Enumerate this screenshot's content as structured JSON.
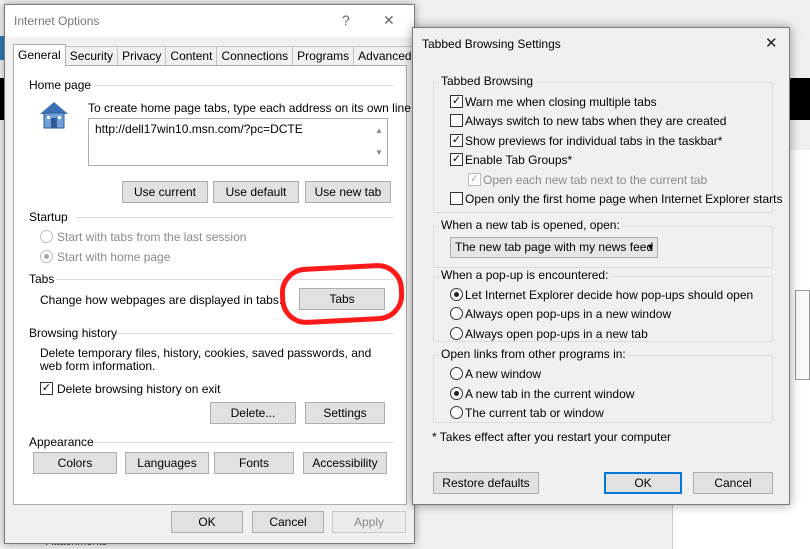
{
  "io": {
    "title": "Internet Options",
    "help": "?",
    "close": "✕",
    "tabs": [
      "General",
      "Security",
      "Privacy",
      "Content",
      "Connections",
      "Programs",
      "Advanced"
    ],
    "home_page": {
      "label": "Home page",
      "desc": "To create home page tabs, type each address on its own line.",
      "url": "http://dell17win10.msn.com/?pc=DCTE",
      "use_current": "Use current",
      "use_default": "Use default",
      "use_new_tab": "Use new tab"
    },
    "startup": {
      "label": "Startup",
      "opt1": "Start with tabs from the last session",
      "opt2": "Start with home page"
    },
    "tabs_group": {
      "label": "Tabs",
      "desc": "Change how webpages are displayed in tabs.",
      "button": "Tabs"
    },
    "history": {
      "label": "Browsing history",
      "desc": "Delete temporary files, history, cookies, saved passwords, and web form information.",
      "delete_on_exit": "Delete browsing history on exit",
      "delete_btn": "Delete...",
      "settings_btn": "Settings"
    },
    "appearance": {
      "label": "Appearance",
      "colors": "Colors",
      "languages": "Languages",
      "fonts": "Fonts",
      "accessibility": "Accessibility"
    },
    "ok": "OK",
    "cancel": "Cancel",
    "apply": "Apply"
  },
  "tbs": {
    "title": "Tabbed Browsing Settings",
    "close": "✕",
    "tabbed": {
      "label": "Tabbed Browsing",
      "warn": "Warn me when closing multiple tabs",
      "always_switch": "Always switch to new tabs when they are created",
      "previews": "Show previews for individual tabs in the taskbar*",
      "groups": "Enable Tab Groups*",
      "open_next": "Open each new tab next to the current tab",
      "first_home": "Open only the first home page when Internet Explorer starts"
    },
    "newtab": {
      "label": "When a new tab is opened, open:",
      "selected": "The new tab page with my news feed"
    },
    "popup": {
      "label": "When a pop-up is encountered:",
      "opt1": "Let Internet Explorer decide how pop-ups should open",
      "opt2": "Always open pop-ups in a new window",
      "opt3": "Always open pop-ups in a new tab"
    },
    "links": {
      "label": "Open links from other programs in:",
      "opt1": "A new window",
      "opt2": "A new tab in the current window",
      "opt3": "The current tab or window"
    },
    "footnote": "* Takes effect after you restart your computer",
    "restore": "Restore defaults",
    "ok": "OK",
    "cancel": "Cancel"
  },
  "background": {
    "attachments": "Attachments"
  }
}
